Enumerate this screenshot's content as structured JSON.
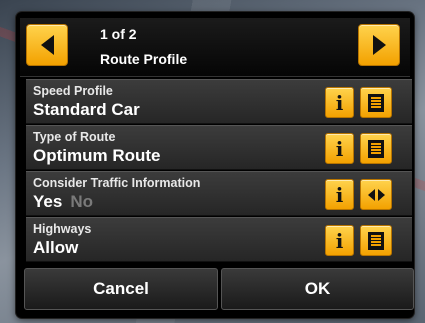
{
  "header": {
    "page_indicator": "1 of 2",
    "title": "Route Profile",
    "prev_icon": "arrow-left-icon",
    "next_icon": "arrow-right-icon"
  },
  "settings": [
    {
      "label": "Speed Profile",
      "value": "Standard Car",
      "action_icon": "list-icon"
    },
    {
      "label": "Type of Route",
      "value": "Optimum Route",
      "action_icon": "list-icon"
    },
    {
      "label": "Consider Traffic Information",
      "value": "Yes",
      "value_alt": "No",
      "action_icon": "toggle-left-right-icon"
    },
    {
      "label": "Highways",
      "value": "Allow",
      "action_icon": "list-icon"
    }
  ],
  "footer": {
    "cancel_label": "Cancel",
    "ok_label": "OK"
  },
  "colors": {
    "accent": "#f3a100",
    "panel_bg": "#000000",
    "row_bg": "#333333",
    "inactive_text": "#7a7a7a"
  }
}
